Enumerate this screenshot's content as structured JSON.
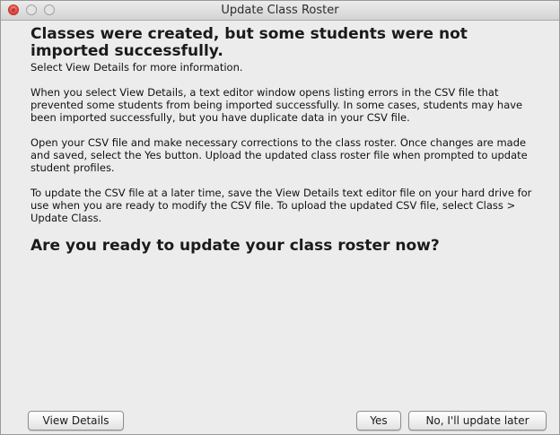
{
  "window": {
    "title": "Update Class Roster"
  },
  "dialog": {
    "heading": "Classes were created, but some students were not imported successfully.",
    "subtext": "Select View Details for more information.",
    "paragraphs": [
      "When you select View Details, a text editor window opens listing errors in the CSV file that prevented some students from being imported successfully. In some cases, students may have been imported successfully, but you have duplicate data in your CSV file.",
      "Open your CSV file and make necessary corrections to the class roster. Once changes are made and saved, select the Yes button. Upload the updated class roster file when prompted to update student profiles.",
      "To update the CSV file at a later time, save the View Details text editor file on your hard drive for use when you are ready to modify the CSV file. To upload the updated CSV file, select Class > Update Class."
    ],
    "question": "Are you ready to update your class roster now?"
  },
  "buttons": {
    "view_details": "View Details",
    "yes": "Yes",
    "later": "No, I'll update later"
  },
  "colors": {
    "close_button": "#e7453c",
    "window_background": "#ececec"
  }
}
